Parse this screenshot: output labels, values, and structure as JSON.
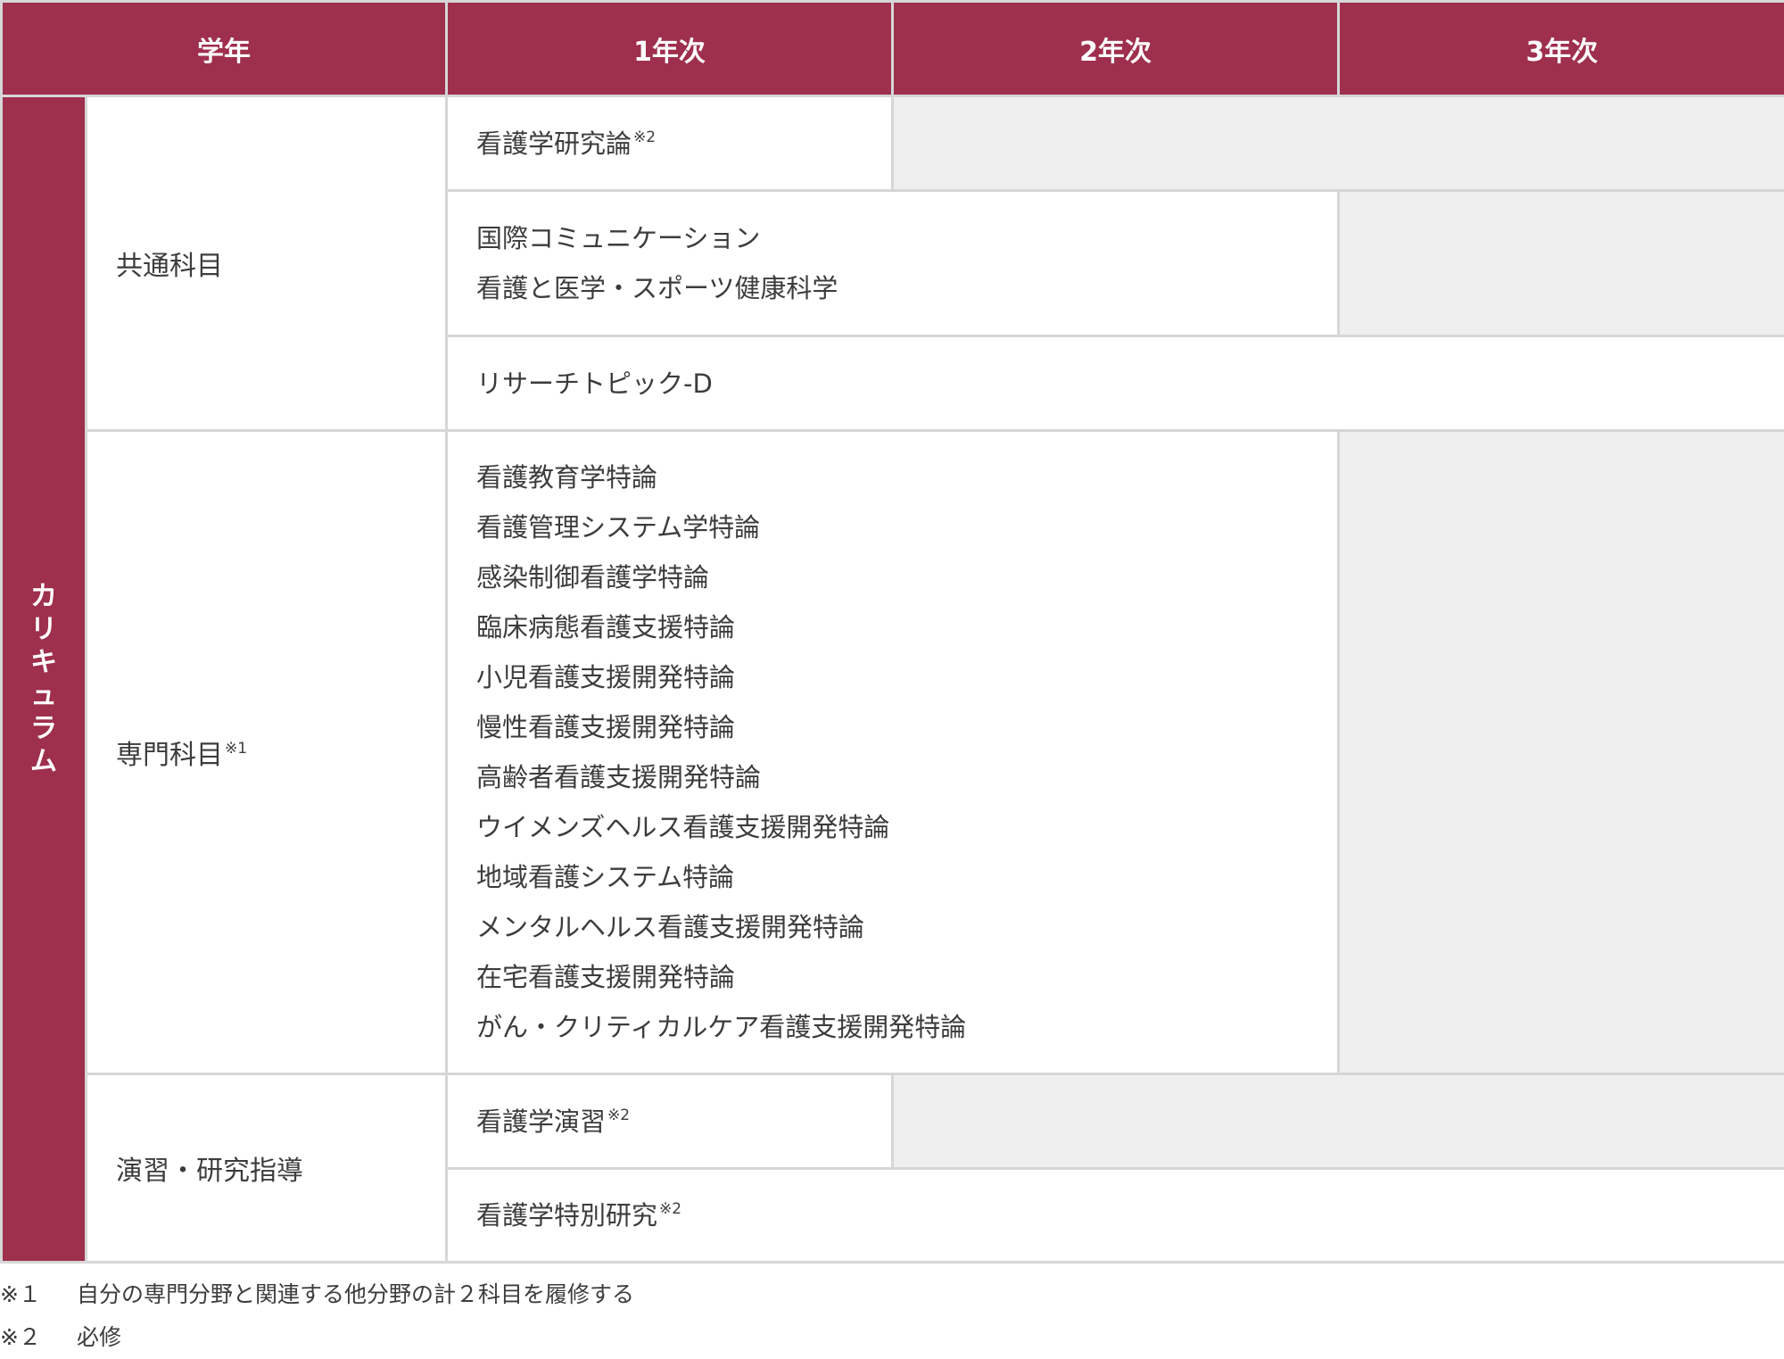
{
  "header": {
    "grade": "学年",
    "year1": "1年次",
    "year2": "2年次",
    "year3": "3年次"
  },
  "side_label": [
    "カ",
    "リ",
    "キ",
    "ュ",
    "ラ",
    "ム"
  ],
  "categories": {
    "common": "共通科目",
    "specialized": "専門科目",
    "specialized_note": "※1",
    "practice": "演習・研究指導"
  },
  "courses": {
    "research_theory": {
      "name": "看護学研究論",
      "note": "※2"
    },
    "intl_comm": "国際コミュニケーション",
    "nursing_medicine_sports": "看護と医学・スポーツ健康科学",
    "research_topic": "リサーチトピック-D",
    "specialized_list": [
      "看護教育学特論",
      "看護管理システム学特論",
      "感染制御看護学特論",
      "臨床病態看護支援特論",
      "小児看護支援開発特論",
      "慢性看護支援開発特論",
      "高齢者看護支援開発特論",
      "ウイメンズヘルス看護支援開発特論",
      "地域看護システム特論",
      "メンタルヘルス看護支援開発特論",
      "在宅看護支援開発特論",
      "がん・クリティカルケア看護支援開発特論"
    ],
    "seminar": {
      "name": "看護学演習",
      "note": "※2"
    },
    "special_research": {
      "name": "看護学特別研究",
      "note": "※2"
    }
  },
  "footnotes": [
    {
      "mark": "※１",
      "text": "自分の専門分野と関連する他分野の計２科目を履修する"
    },
    {
      "mark": "※２",
      "text": "必修"
    }
  ],
  "colors": {
    "accent": "#9e2f4d",
    "inactive_cell": "#efefef",
    "border": "#d6d6d6"
  }
}
